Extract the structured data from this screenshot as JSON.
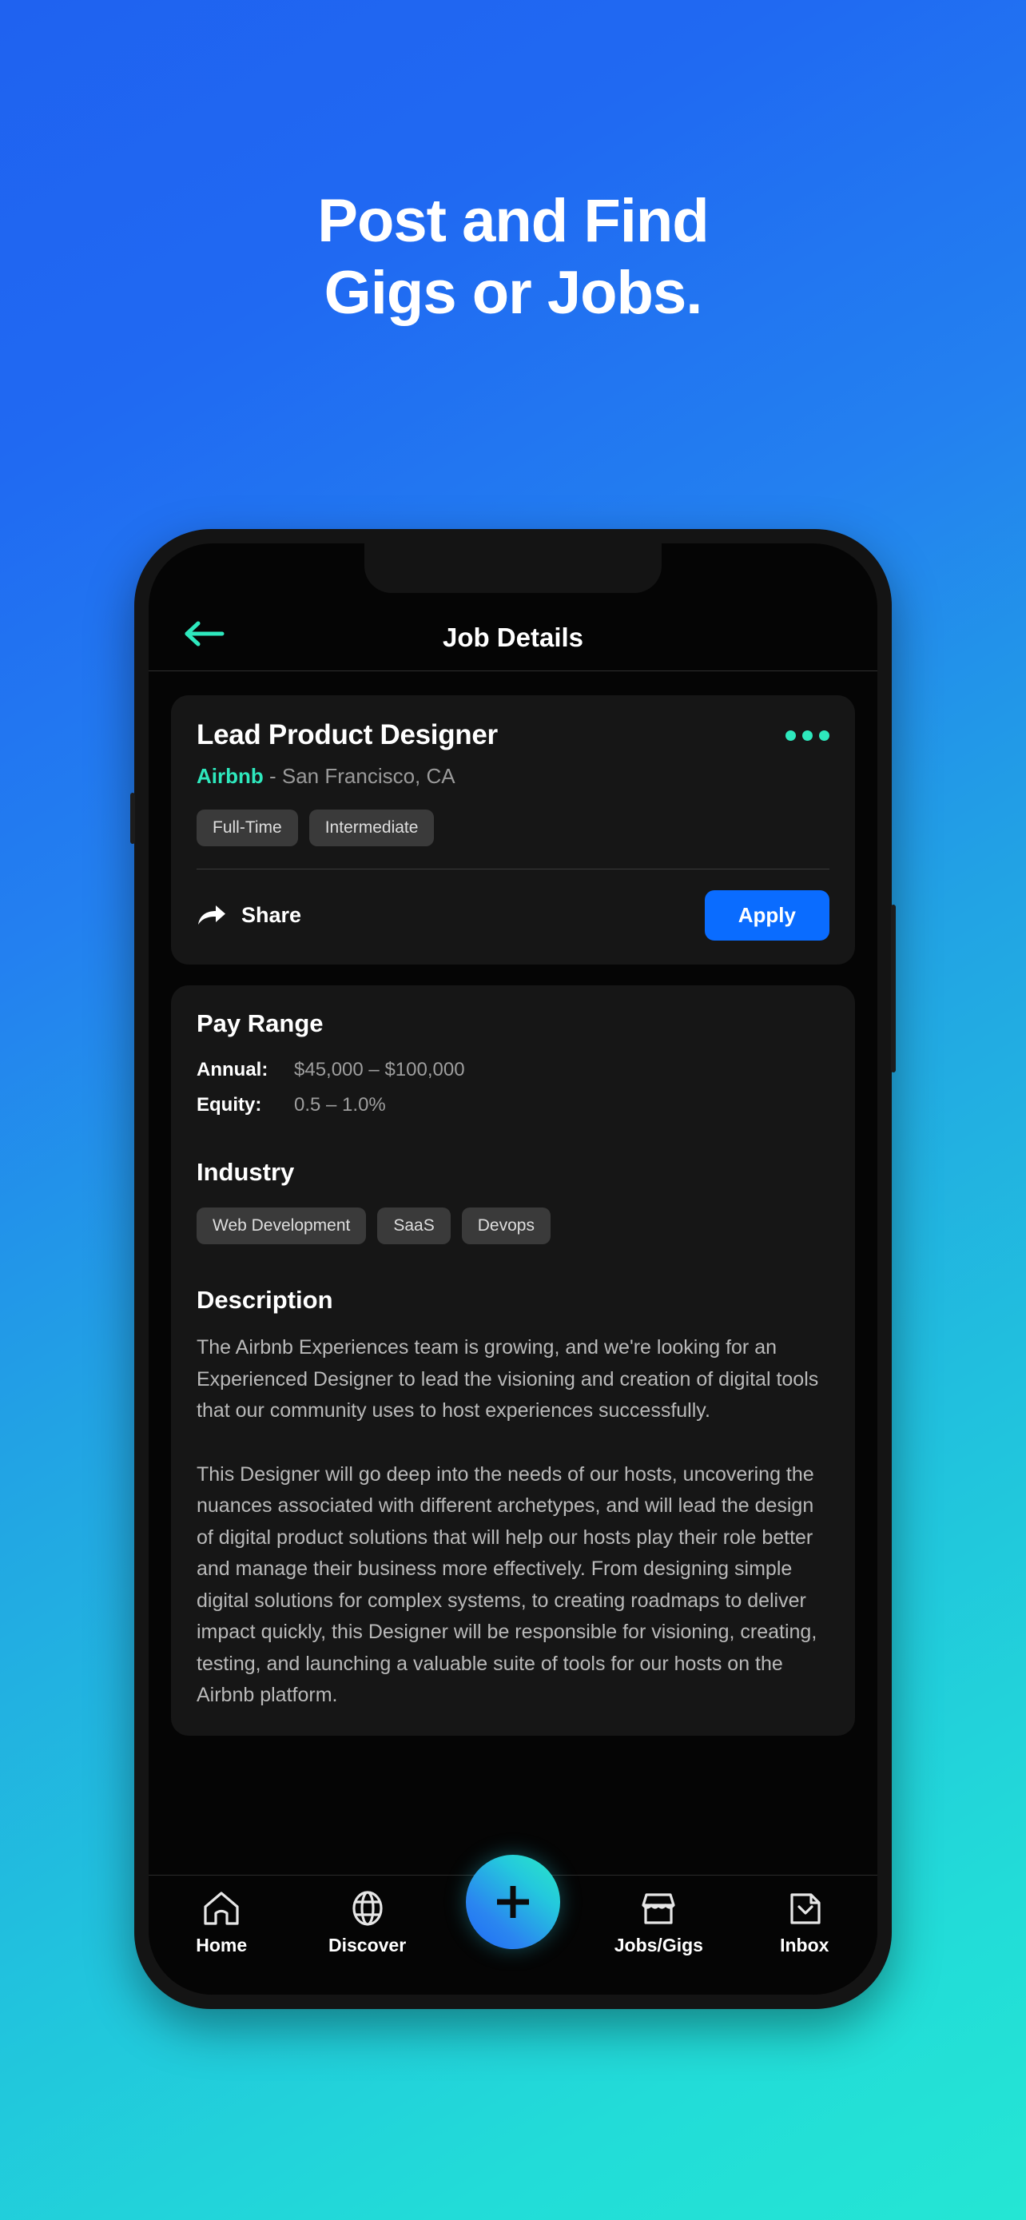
{
  "hero": {
    "line1": "Post and Find",
    "line2": "Gigs or Jobs."
  },
  "colors": {
    "accent_teal": "#2ee8bd",
    "accent_blue": "#0a6cff",
    "bg_gradient_start": "#1f62f0",
    "bg_gradient_end": "#24e6d4",
    "card_bg": "#161616",
    "screen_bg": "#050505"
  },
  "app": {
    "header": {
      "title": "Job Details",
      "back_icon": "arrow-left-icon"
    },
    "job": {
      "title": "Lead Product Designer",
      "menu_icon": "more-options-icon",
      "company": "Airbnb",
      "separator": " - ",
      "location": "San Francisco, CA",
      "tags": [
        "Full-Time",
        "Intermediate"
      ],
      "share_label": "Share",
      "share_icon": "share-icon",
      "apply_label": "Apply"
    },
    "pay": {
      "section_title": "Pay Range",
      "rows": [
        {
          "key": "Annual:",
          "value": "$45,000 – $100,000"
        },
        {
          "key": "Equity:",
          "value": "0.5 – 1.0%"
        }
      ]
    },
    "industry": {
      "section_title": "Industry",
      "tags": [
        "Web Development",
        "SaaS",
        "Devops"
      ]
    },
    "description": {
      "section_title": "Description",
      "paragraphs": [
        "The Airbnb Experiences team is growing, and we're looking for an Experienced Designer to lead the visioning and creation of digital tools that our community uses to host experiences successfully.",
        "This Designer will go deep into the needs of our hosts, uncovering the nuances associated with different archetypes, and will lead the design of digital product solutions that will help our hosts play their role better and manage their business more effectively. From designing simple digital solutions for complex systems, to creating roadmaps to deliver impact quickly, this Designer will be responsible for visioning, creating, testing, and launching a valuable suite of tools for our hosts on the Airbnb platform."
      ]
    },
    "tabbar": {
      "items": [
        {
          "label": "Home",
          "icon": "home-icon"
        },
        {
          "label": "Discover",
          "icon": "globe-icon"
        },
        {
          "label": "Jobs/Gigs",
          "icon": "store-icon"
        },
        {
          "label": "Inbox",
          "icon": "inbox-icon"
        }
      ],
      "fab_icon": "plus-icon"
    }
  }
}
